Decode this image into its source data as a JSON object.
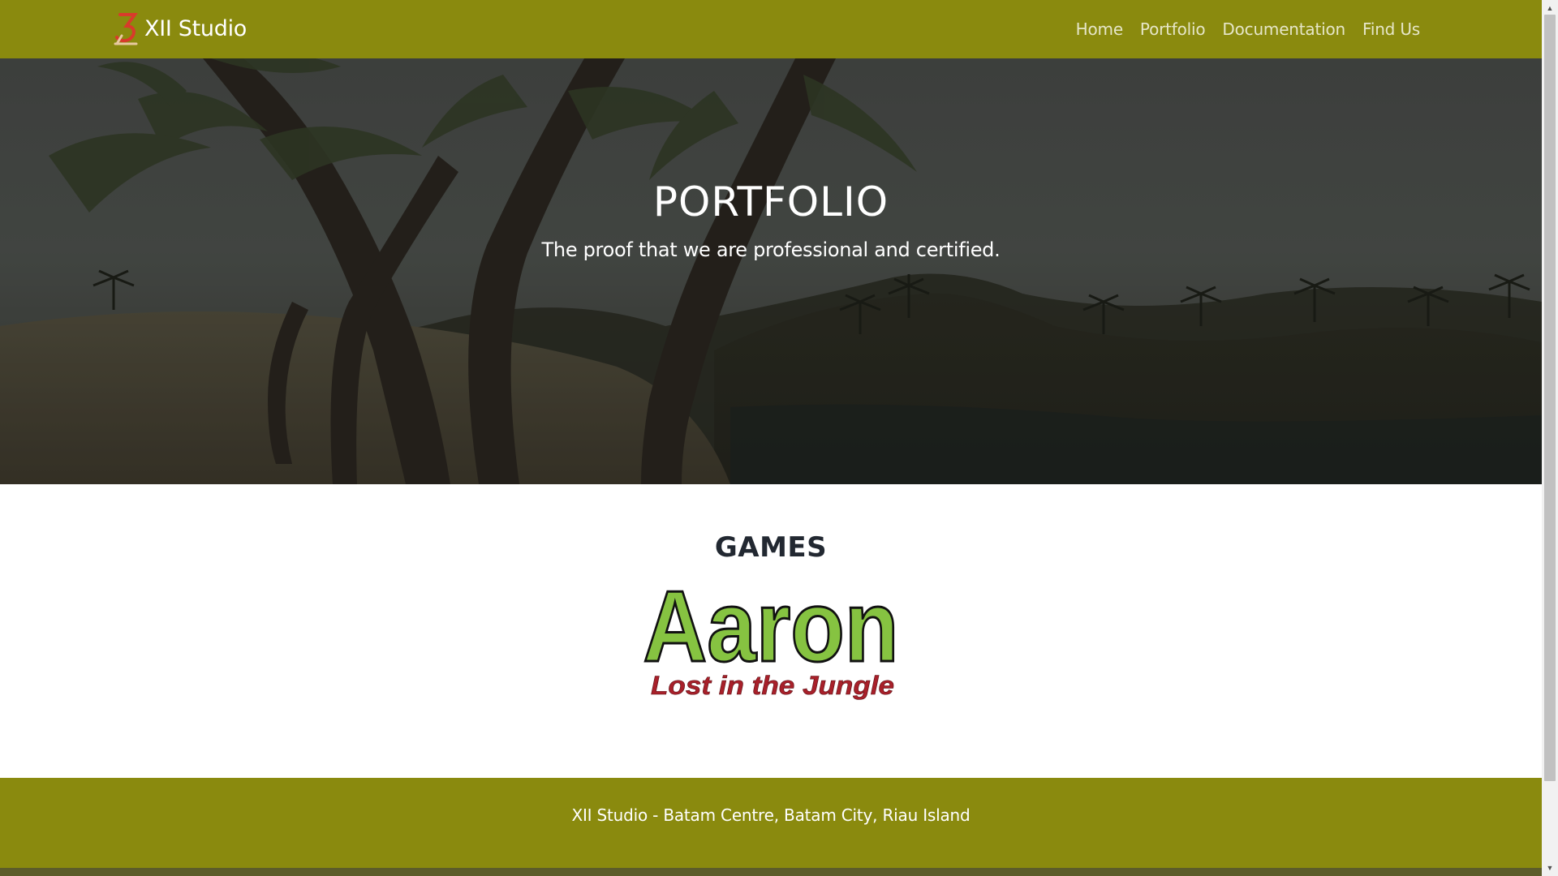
{
  "navbar": {
    "brand": "XII Studio",
    "links": [
      "Home",
      "Portfolio",
      "Documentation",
      "Find Us"
    ]
  },
  "hero": {
    "title": "PORTFOLIO",
    "subtitle": "The proof that we are professional and certified."
  },
  "games": {
    "heading": "GAMES",
    "items": [
      {
        "title": "Aaron",
        "subtitle": "Lost in the Jungle"
      }
    ]
  },
  "footer": {
    "text": "XII Studio - Batam Centre, Batam City, Riau Island"
  },
  "icons": {
    "brand_logo": "xii-studio-logo-icon",
    "scroll_up": "chevron-up-icon",
    "scroll_down": "chevron-down-icon"
  },
  "colors": {
    "navbar": "#8a8a0e",
    "footer": "#8a8a0e",
    "game_title_fill": "#86c341",
    "game_subtitle_fill": "#a8202a",
    "heading": "#222831"
  }
}
